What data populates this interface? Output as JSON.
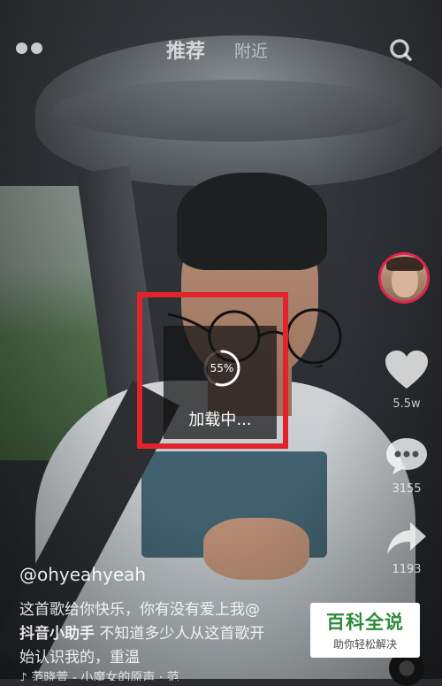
{
  "header": {
    "tabs": [
      {
        "label": "推荐",
        "active": true
      },
      {
        "label": "附近",
        "active": false
      }
    ],
    "menu_icon": "dots-menu-icon",
    "search_icon": "search-icon"
  },
  "sidebar": {
    "avatar_icon": "creator-avatar",
    "like": {
      "icon": "heart-icon",
      "count": "5.5w"
    },
    "comment": {
      "icon": "comment-bubble-icon",
      "count": "3155"
    },
    "share": {
      "icon": "share-arrow-icon",
      "count": "1193"
    }
  },
  "loading": {
    "progress_label": "55%",
    "progress_value": 0.55,
    "text": "加载中..."
  },
  "post": {
    "username": "@ohyeahyeah",
    "caption_line1": "这首歌给你快乐，你有没有爱上我@",
    "caption_mention": "抖音小助手",
    "caption_line2_rest": " 不知道多少人从这首歌开",
    "caption_line3": "始认识我的，重温",
    "music_text": "♪ 范晓萱 - 小魔女的原声 · 范"
  },
  "watermark": {
    "title": "百科全说",
    "subtitle": "助你轻松解决"
  },
  "colors": {
    "highlight": "#e3232c",
    "avatar_ring": "#e2234d",
    "watermark_green": "#2e8b3a"
  }
}
